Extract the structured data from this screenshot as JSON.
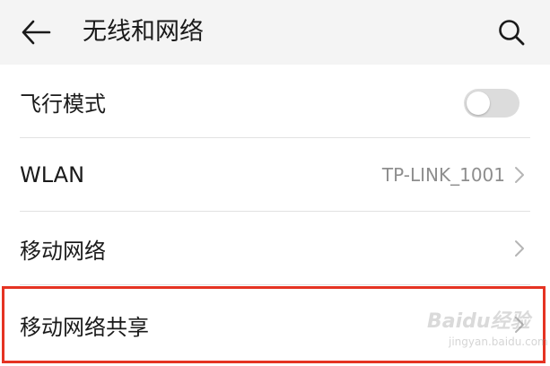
{
  "header": {
    "title": "无线和网络",
    "back_icon": "arrow-left-icon",
    "search_icon": "search-icon"
  },
  "settings": {
    "airplane_mode": {
      "label": "飞行模式",
      "toggle_on": false
    },
    "wlan": {
      "label": "WLAN",
      "value": "TP-LINK_1001"
    },
    "mobile_network": {
      "label": "移动网络"
    },
    "tethering": {
      "label": "移动网络共享",
      "highlighted": true
    }
  },
  "watermark": {
    "text": "Baidu经验",
    "subtext": "jingyan.baidu.com"
  },
  "colors": {
    "header_bg": "#f4f4f4",
    "highlight_border": "#e53323",
    "toggle_off": "#dcdcdc",
    "secondary_text": "#8e8e8e"
  }
}
